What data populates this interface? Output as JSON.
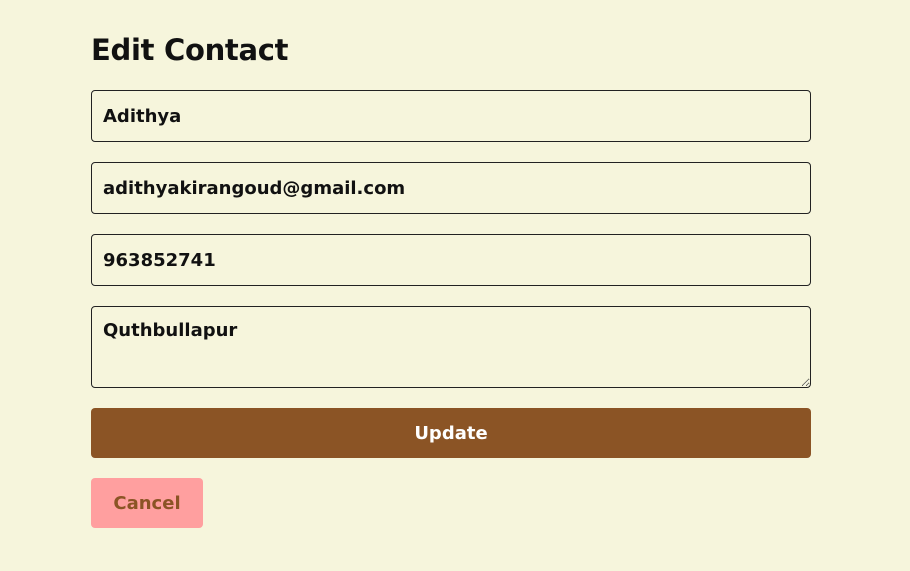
{
  "form": {
    "title": "Edit Contact",
    "name_value": "Adithya",
    "email_value": "adithyakirangoud@gmail.com",
    "phone_value": "963852741",
    "address_value": "Quthbullapur",
    "update_label": "Update",
    "cancel_label": "Cancel"
  },
  "colors": {
    "background": "#f6f5dc",
    "primary": "#8b5425",
    "cancel_bg": "#ff9f9f"
  }
}
